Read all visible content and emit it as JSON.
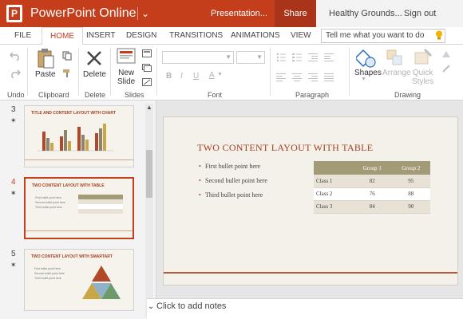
{
  "titlebar": {
    "app_name": "PowerPoint Online",
    "document_name": "Presentation...",
    "share_label": "Share",
    "user_name": "Healthy Grounds...",
    "signout_label": "Sign out",
    "logo_letter": "P"
  },
  "tabs": [
    {
      "label": "FILE"
    },
    {
      "label": "HOME"
    },
    {
      "label": "INSERT"
    },
    {
      "label": "DESIGN"
    },
    {
      "label": "TRANSITIONS"
    },
    {
      "label": "ANIMATIONS"
    },
    {
      "label": "VIEW"
    }
  ],
  "active_tab": "HOME",
  "tellme_placeholder": "Tell me what you want to do",
  "ribbon": {
    "groups": {
      "undo": "Undo",
      "clipboard": "Clipboard",
      "delete": "Delete",
      "slides": "Slides",
      "font": "Font",
      "paragraph": "Paragraph",
      "drawing": "Drawing"
    },
    "paste_label": "Paste",
    "delete_label": "Delete",
    "new_slide_line1": "New",
    "new_slide_line2": "Slide",
    "shapes_label": "Shapes",
    "arrange_label": "Arrange",
    "quick_styles_line1": "Quick",
    "quick_styles_line2": "Styles"
  },
  "thumbnails": [
    {
      "number": "3",
      "title": "TITLE AND CONTENT LAYOUT WITH CHART"
    },
    {
      "number": "4",
      "title": "TWO CONTENT LAYOUT WITH TABLE",
      "bullets": [
        "First bullet point here",
        "Second bullet point here",
        "Third bullet point here"
      ]
    },
    {
      "number": "5",
      "title": "TWO CONTENT LAYOUT WITH SMARTART",
      "bullets": [
        "First bullet point here",
        "Second bullet point here",
        "Third bullet point here"
      ]
    }
  ],
  "current_slide": {
    "title": "TWO CONTENT LAYOUT WITH TABLE",
    "bullets": [
      "First bullet point here",
      "Second bullet point here",
      "Third bullet point here"
    ],
    "table": {
      "headers": [
        "",
        "Group 1",
        "Group 2"
      ],
      "rows": [
        [
          "Class 1",
          "82",
          "95"
        ],
        [
          "Class 2",
          "76",
          "88"
        ],
        [
          "Class 3",
          "84",
          "90"
        ]
      ]
    }
  },
  "notes_placeholder": "Click to add notes",
  "colors": {
    "accent": "#c43e1c",
    "table_header": "#a39a78",
    "slide_title": "#a53f1e"
  }
}
